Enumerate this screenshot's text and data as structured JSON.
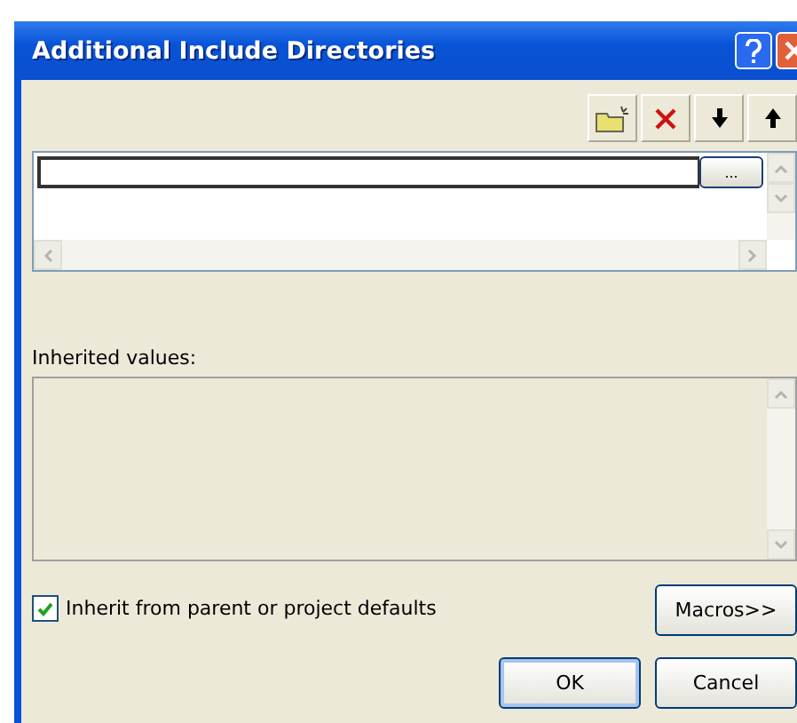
{
  "window": {
    "title": "Additional Include Directories"
  },
  "toolbar": {
    "buttons": [
      {
        "kind": "new-folder"
      },
      {
        "kind": "delete"
      },
      {
        "kind": "down"
      },
      {
        "kind": "up"
      }
    ]
  },
  "directory_list": {
    "rows": [
      {
        "value": "",
        "browse_label": "..."
      }
    ]
  },
  "inherited": {
    "label": "Inherited values:"
  },
  "inherit_checkbox": {
    "label": "Inherit from parent or project defaults",
    "checked": true
  },
  "buttons": {
    "macros": "Macros>>",
    "ok": "OK",
    "cancel": "Cancel"
  }
}
